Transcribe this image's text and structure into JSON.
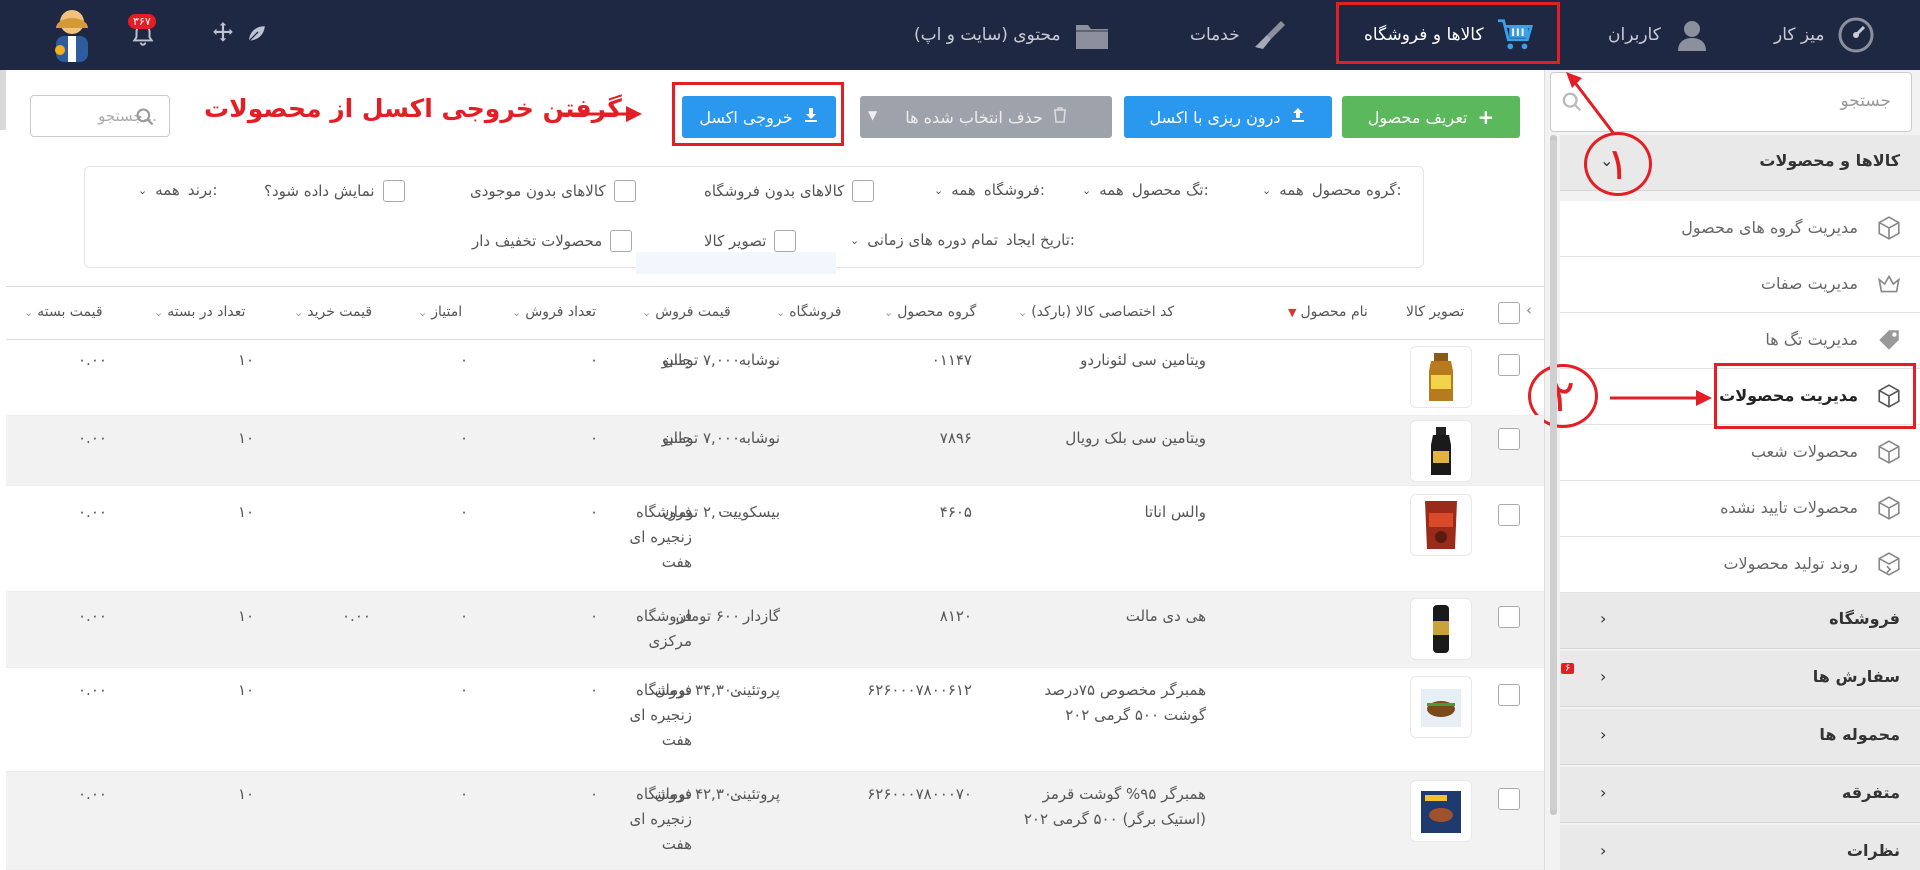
{
  "topbar": {
    "items": [
      {
        "label": "میز کار",
        "icon": "gauge-icon"
      },
      {
        "label": "کاربران",
        "icon": "users-icon"
      },
      {
        "label": "کالاها و فروشگاه",
        "icon": "cart-icon"
      },
      {
        "label": "خدمات",
        "icon": "brush-icon"
      },
      {
        "label": "محتوی (سایت و اپ)",
        "icon": "folder-icon"
      }
    ],
    "notification_count": "۳۶۷"
  },
  "sidebar": {
    "search_placeholder": "جستجو",
    "section_products": "کالاها و محصولات",
    "items": [
      "مدیریت گروه های محصول",
      "مدیریت صفات",
      "مدیریت تگ ها",
      "مدیریت محصولات",
      "محصولات شعب",
      "محصولات تایید نشده",
      "روند تولید محصولات"
    ],
    "sections": [
      {
        "label": "فروشگاه"
      },
      {
        "label": "سفارش ها",
        "badge": "۶"
      },
      {
        "label": "محموله ها"
      },
      {
        "label": "متفرقه"
      },
      {
        "label": "نظرات"
      }
    ]
  },
  "annotations": {
    "circle1": "۱",
    "circle2": "۲",
    "export_note": "گرفتن خروجی اکسل از محصولات"
  },
  "toolbar": {
    "define_product": "تعریف محصول",
    "import_excel": "درون ریزی با اکسل",
    "delete_selected": "حذف انتخاب شده ها",
    "export_excel": "خروجی اکسل",
    "search_placeholder": "جستجو..."
  },
  "filters": {
    "group_label": "گروه محصول:",
    "group_value": "همه",
    "tag_label": "تگ محصول:",
    "tag_value": "همه",
    "store_label": "فروشگاه:",
    "store_value": "همه",
    "no_store": "کالاهای بدون فروشگاه",
    "no_stock": "کالاهای بدون موجودی",
    "show_label": "نمایش داده شود؟",
    "brand_label": "برند:",
    "brand_value": "همه",
    "created_label": "تاریخ ایجاد:",
    "created_value": "تمام دوره های زمانی",
    "product_image": "تصویر کالا",
    "discounted": "محصولات تخفیف دار"
  },
  "table": {
    "headers": [
      "تصویر کالا",
      "نام محصول",
      "کد اختصاصی کالا (بارکد)",
      "گروه محصول",
      "فروشگاه",
      "قیمت فروش",
      "تعداد فروش",
      "امتیاز",
      "قیمت خرید",
      "تعداد در بسته",
      "قیمت بسته"
    ],
    "rows": [
      {
        "name": "ویتامین سی لئوناردو",
        "code": "۰۱۱۴۷",
        "group": "نوشابه",
        "store": "جانبو",
        "price": "۷,۰۰۰ تومان",
        "sales": "۰",
        "score": "۰",
        "buy": "",
        "pack_count": "۱۰",
        "pack_price": "۰.۰۰"
      },
      {
        "name": "ویتامین سی بلک رویال",
        "code": "۷۸۹۶",
        "group": "نوشابه",
        "store": "جانبو",
        "price": "۷,۰۰۰ تومان",
        "sales": "۰",
        "score": "۰",
        "buy": "",
        "pack_count": "۱۰",
        "pack_price": "۰.۰۰"
      },
      {
        "name": "والس اناتا",
        "code": "۴۶۰۵",
        "group": "بیسکوییت",
        "store": "فروشگاه زنجیره ای هفت",
        "price": "۲,۰۰۰ تومان",
        "sales": "۰",
        "score": "۰",
        "buy": "",
        "pack_count": "۱۰",
        "pack_price": "۰.۰۰"
      },
      {
        "name": "هی دی مالت",
        "code": "۸۱۲۰",
        "group": "گازدار",
        "store": "فروشگاه مرکزی",
        "price": "۶۰۰ تومان",
        "sales": "۰",
        "score": "۰",
        "buy": "۰.۰۰",
        "pack_count": "۱۰",
        "pack_price": "۰.۰۰"
      },
      {
        "name": "همبرگر مخصوص ۷۵درصد گوشت ۵۰۰ گرمی ۲۰۲",
        "code": "۶۲۶۰۰۰۷۸۰۰۶۱۲",
        "group": "پروتئینی",
        "store": "فروشگاه زنجیره ای هفت",
        "price": "۳۴,۳۰۰ تومان",
        "sales": "۰",
        "score": "۰",
        "buy": "",
        "pack_count": "۱۰",
        "pack_price": "۰.۰۰"
      },
      {
        "name": "همبرگر ۹۵% گوشت قرمز (استیک برگر) ۵۰۰ گرمی ۲۰۲",
        "code": "۶۲۶۰۰۰۷۸۰۰۰۷۰",
        "group": "پروتئینی",
        "store": "فروشگاه زنجیره ای هفت",
        "price": "۴۲,۳۰۰ تومان",
        "sales": "۰",
        "score": "۰",
        "buy": "",
        "pack_count": "۱۰",
        "pack_price": "۰.۰۰"
      }
    ]
  }
}
